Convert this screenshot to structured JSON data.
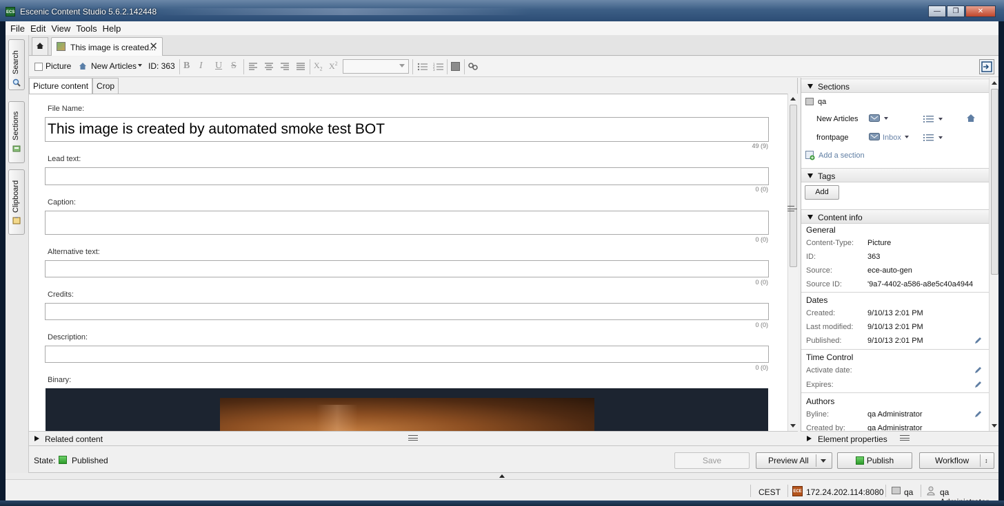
{
  "window": {
    "title": "Escenic Content Studio 5.6.2.142448",
    "app_icon": "ECS"
  },
  "menu": [
    "File",
    "Edit",
    "View",
    "Tools",
    "Help"
  ],
  "left_dock": {
    "tabs": [
      {
        "label": "Search",
        "icon": "search-icon"
      },
      {
        "label": "Sections",
        "icon": "sections-icon"
      },
      {
        "label": "Clipboard",
        "icon": "clipboard-icon"
      }
    ]
  },
  "tabs": {
    "document_tab": "This image is created...",
    "close": "✕"
  },
  "toolbar": {
    "type_label": "Picture",
    "section_label": "New Articles",
    "id_label": "ID: 363",
    "format_buttons": [
      "B",
      "I",
      "U",
      "S"
    ]
  },
  "editor": {
    "subtabs": [
      "Picture content",
      "Crop"
    ],
    "fields": [
      {
        "label": "File Name:",
        "value": "This image is created by automated smoke test BOT",
        "count": "49 (9)"
      },
      {
        "label": "Lead text:",
        "value": "",
        "count": "0 (0)"
      },
      {
        "label": "Caption:",
        "value": "",
        "count": "0 (0)"
      },
      {
        "label": "Alternative text:",
        "value": "",
        "count": "0 (0)"
      },
      {
        "label": "Credits:",
        "value": "",
        "count": "0 (0)"
      },
      {
        "label": "Description:",
        "value": "",
        "count": "0 (0)"
      }
    ],
    "binary_label": "Binary:"
  },
  "related_content": "Related content",
  "right_panel": {
    "sections": {
      "title": "Sections",
      "root": "qa",
      "rows": [
        {
          "name": "New Articles",
          "state": ""
        },
        {
          "name": "frontpage",
          "state": "Inbox"
        }
      ],
      "add": "Add a section"
    },
    "tags": {
      "title": "Tags",
      "add_button": "Add"
    },
    "content_info": {
      "title": "Content info",
      "general": {
        "heading": "General",
        "rows": [
          {
            "key": "Content-Type:",
            "value": "Picture"
          },
          {
            "key": "ID:",
            "value": "363"
          },
          {
            "key": "Source:",
            "value": "ece-auto-gen"
          },
          {
            "key": "Source ID:",
            "value": "'9a7-4402-a586-a8e5c40a4944"
          }
        ]
      },
      "dates": {
        "heading": "Dates",
        "rows": [
          {
            "key": "Created:",
            "value": "9/10/13 2:01 PM"
          },
          {
            "key": "Last modified:",
            "value": "9/10/13 2:01 PM"
          },
          {
            "key": "Published:",
            "value": "9/10/13 2:01 PM"
          }
        ]
      },
      "time_control": {
        "heading": "Time Control",
        "rows": [
          {
            "key": "Activate date:",
            "value": ""
          },
          {
            "key": "Expires:",
            "value": ""
          }
        ]
      },
      "authors": {
        "heading": "Authors",
        "rows": [
          {
            "key": "Byline:",
            "value": "qa Administrator"
          },
          {
            "key": "Created by:",
            "value": "qa Administrator"
          }
        ]
      }
    },
    "element_properties": "Element properties"
  },
  "statebar": {
    "state_label": "State:",
    "state_value": "Published",
    "save": "Save",
    "preview": "Preview All",
    "publish": "Publish",
    "workflow": "Workflow"
  },
  "statusbar": {
    "timezone": "CEST",
    "server": "172.24.202.114:8080",
    "publication": "qa",
    "user": "qa Administrator"
  },
  "colors": {
    "published_green": "#2d9b2a",
    "title_bar": "#3d5f86"
  }
}
